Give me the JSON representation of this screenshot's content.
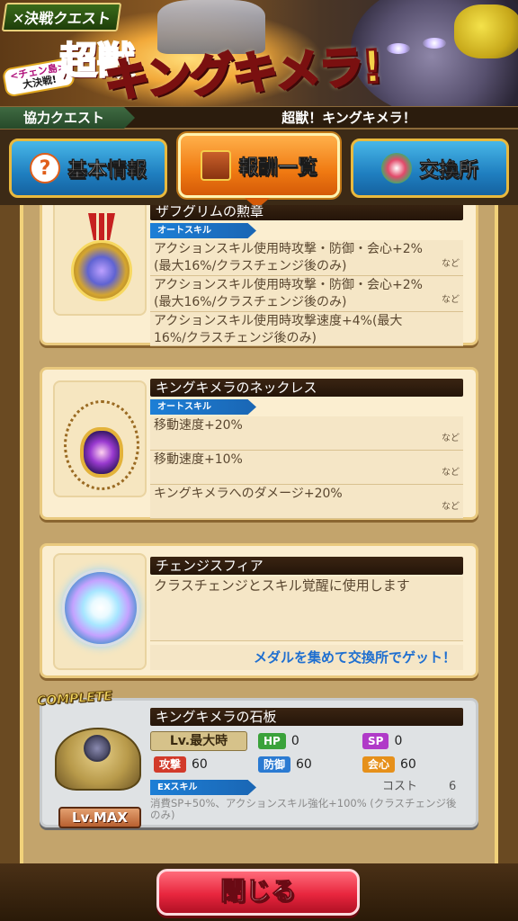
{
  "banner": {
    "quest_label": "✕決戦クエスト",
    "super_kanji": "超獣",
    "event_line1": "<チェン島>",
    "event_line2": "大決戦!",
    "boss_title": "キングキメラ!"
  },
  "subtitle": {
    "quest_type": "協力クエスト",
    "quest_name": "超獣！キングキメラ！"
  },
  "tabs": [
    {
      "label": "基本情報",
      "icon": "question-icon",
      "active": false
    },
    {
      "label": "報酬一覧",
      "icon": "treasure-chest-icon",
      "active": true
    },
    {
      "label": "交換所",
      "icon": "exchange-icon",
      "active": false
    }
  ],
  "rewards": [
    {
      "name": "ザフグリムの勲章",
      "skill_type": "オートスキル",
      "icon": "medal-icon",
      "effects": [
        {
          "text": "アクションスキル使用時攻撃・防御・会心+2%(最大16%/クラスチェンジ後のみ)",
          "suffix": "など"
        },
        {
          "text": "アクションスキル使用時攻撃・防御・会心+2%(最大16%/クラスチェンジ後のみ)",
          "suffix": "など"
        },
        {
          "text": "アクションスキル使用時攻撃速度+4%(最大16%/クラスチェンジ後のみ)",
          "suffix": ""
        }
      ]
    },
    {
      "name": "キングキメラのネックレス",
      "skill_type": "オートスキル",
      "icon": "necklace-icon",
      "effects": [
        {
          "text": "移動速度+20%",
          "suffix": "など"
        },
        {
          "text": "移動速度+10%",
          "suffix": "など"
        },
        {
          "text": "キングキメラへのダメージ+20%",
          "suffix": "など"
        }
      ]
    },
    {
      "name": "チェンジスフィア",
      "icon": "sphere-icon",
      "description": "クラスチェンジとスキル覚醒に使用します",
      "hint": "メダルを集めて交換所でゲット！"
    }
  ],
  "stone": {
    "complete_label": "COMPLETE",
    "name": "キングキメラの石板",
    "level_label": "Lv.最大時",
    "hp_label": "HP",
    "hp": "0",
    "sp_label": "SP",
    "sp": "0",
    "atk_label": "攻撃",
    "atk": "60",
    "def_label": "防御",
    "def": "60",
    "crit_label": "会心",
    "crit": "60",
    "ex_skill_label": "EXスキル",
    "cost_label": "コスト",
    "cost": "6",
    "effect": "消費SP+50%、アクションスキル強化+100% (クラスチェンジ後のみ)",
    "lv_max": "Lv.MAX"
  },
  "footer": {
    "close_label": "閉じる"
  },
  "colors": {
    "active_tab": "#f07a12",
    "inactive_tab": "#1f7fc0",
    "skill_ribbon": "#1d7fd6",
    "hint_text": "#1f6fd0",
    "close_button": "#e8263e"
  }
}
